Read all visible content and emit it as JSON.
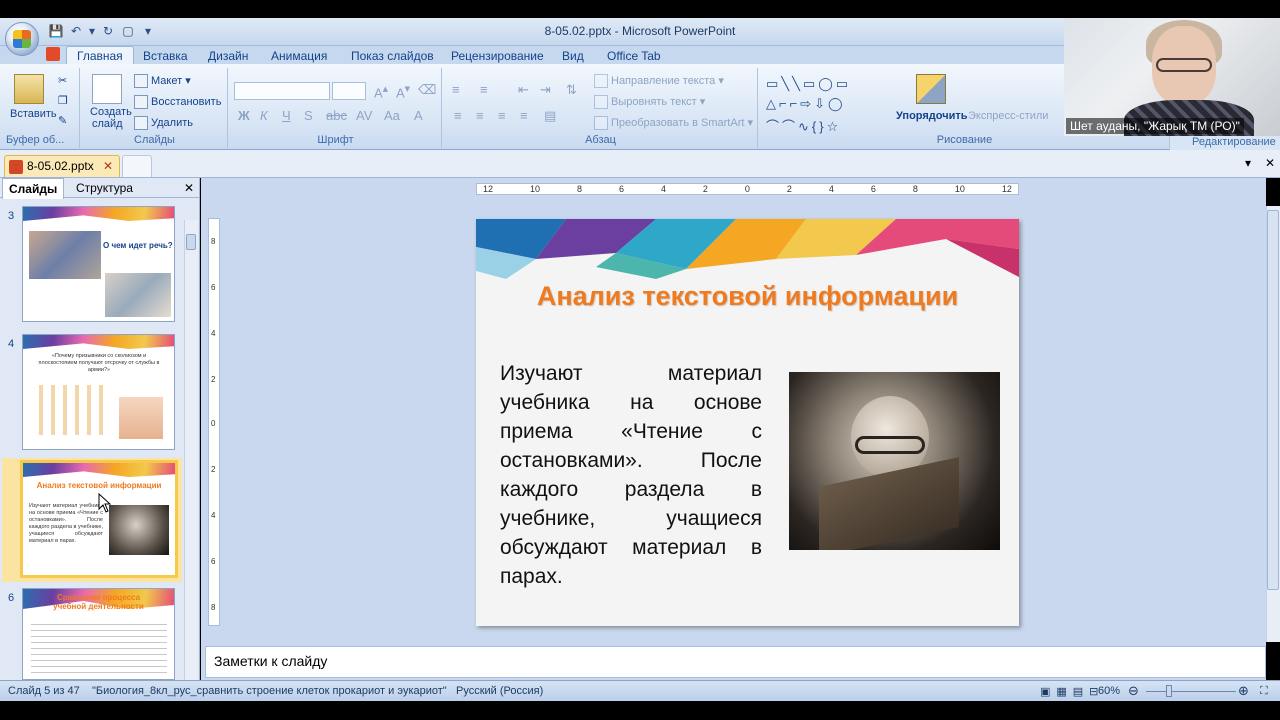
{
  "window": {
    "title": "8-05.02.pptx - Microsoft PowerPoint"
  },
  "ribbon_tabs": [
    "Главная",
    "Вставка",
    "Дизайн",
    "Анимация",
    "Показ слайдов",
    "Рецензирование",
    "Вид",
    "Office Tab"
  ],
  "ribbon": {
    "clipboard": {
      "paste": "Вставить",
      "label": "Буфер об..."
    },
    "slides": {
      "create": "Создать",
      "create2": "слайд",
      "layout": "Макет",
      "reset": "Восстановить",
      "delete": "Удалить",
      "label": "Слайды"
    },
    "font": {
      "label": "Шрифт"
    },
    "paragraph": {
      "direction": "Направление текста",
      "align": "Выровнять текст",
      "smartart": "Преобразовать в SmartArt",
      "label": "Абзац"
    },
    "drawing": {
      "arrange": "Упорядочить",
      "styles": "Экспресс-стили",
      "label": "Рисование"
    },
    "editing": {
      "label": "Редактирование"
    }
  },
  "webcam": {
    "caption": "Шет ауданы, \"Жарық ТМ (РО)\""
  },
  "doc_tab": {
    "name": "8-05.02.pptx"
  },
  "left_panel": {
    "tab_slides": "Слайды",
    "tab_outline": "Структура",
    "thumbs": [
      {
        "num": "3",
        "title": "О чем идет речь?"
      },
      {
        "num": "4",
        "title": "«Почему призывники со сколиозом и плоскостопием получают отсрочку от службы в армии?»"
      },
      {
        "num": "5",
        "title": "Анализ текстовой информации",
        "text": "Изучают материал учебника на основе приема «Чтение с остановками». После каждого раздела в учебнике, учащиеся обсуждают материал в парах."
      },
      {
        "num": "6",
        "title": "Сравнение процесса учебной деятельности"
      }
    ]
  },
  "slide": {
    "title": "Анализ текстовой информации",
    "body": "Изучают материал учебника на основе приема «Чтение с остановками». После каждого раздела в учебнике, учащиеся обсуждают материал в парах."
  },
  "ruler": {
    "h": [
      "12",
      "10",
      "8",
      "6",
      "4",
      "2",
      "0",
      "2",
      "4",
      "6",
      "8",
      "10",
      "12"
    ],
    "v": [
      "8",
      "6",
      "4",
      "2",
      "0",
      "2",
      "4",
      "6",
      "8"
    ]
  },
  "notes": {
    "placeholder": "Заметки к слайду"
  },
  "status": {
    "slide": "Слайд 5 из 47",
    "theme": "\"Биология_8кл_рус_сравнить строение клеток прокариот и эукариот\"",
    "lang": "Русский (Россия)",
    "zoom": "60%"
  },
  "colors": {
    "accent": "#f07a1e",
    "ribbon": "#c6d8ee",
    "selection": "#f6c94c"
  }
}
